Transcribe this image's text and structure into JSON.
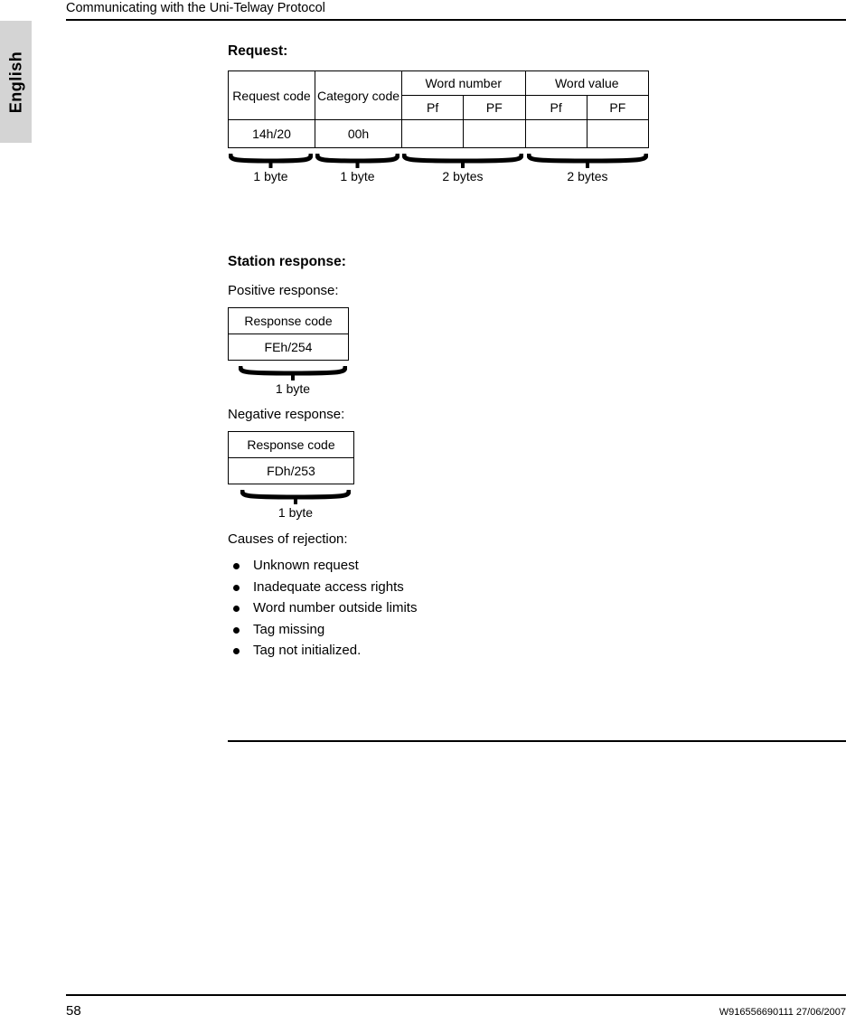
{
  "header": {
    "title": "Communicating with the Uni-Telway Protocol"
  },
  "language_tab": {
    "label": "English"
  },
  "request_section": {
    "heading": "Request:",
    "table": {
      "group_headers": [
        {
          "label": "Request code",
          "colspan": 1
        },
        {
          "label": "Category code",
          "colspan": 1
        },
        {
          "label": "Word number",
          "colspan": 2
        },
        {
          "label": "Word value",
          "colspan": 2
        }
      ],
      "sub_headers": [
        "Pf",
        "PF",
        "Pf",
        "PF"
      ],
      "values": [
        "14h/20",
        "00h",
        "",
        "",
        "",
        ""
      ]
    },
    "byte_labels": [
      "1 byte",
      "1 byte",
      "2 bytes",
      "2 bytes"
    ]
  },
  "station_response": {
    "heading": "Station response:",
    "positive": {
      "label": "Positive response:",
      "header": "Response code",
      "value": "FEh/254",
      "byte_label": "1 byte"
    },
    "negative": {
      "label": "Negative response:",
      "header": "Response code",
      "value": "FDh/253",
      "byte_label": "1 byte"
    }
  },
  "rejection": {
    "label": "Causes of rejection:",
    "items": [
      "Unknown request",
      "Inadequate access rights",
      "Word number outside limits",
      "Tag missing",
      "Tag not initialized."
    ]
  },
  "footer": {
    "page_number": "58",
    "reference": "W916556690111 27/06/2007"
  }
}
